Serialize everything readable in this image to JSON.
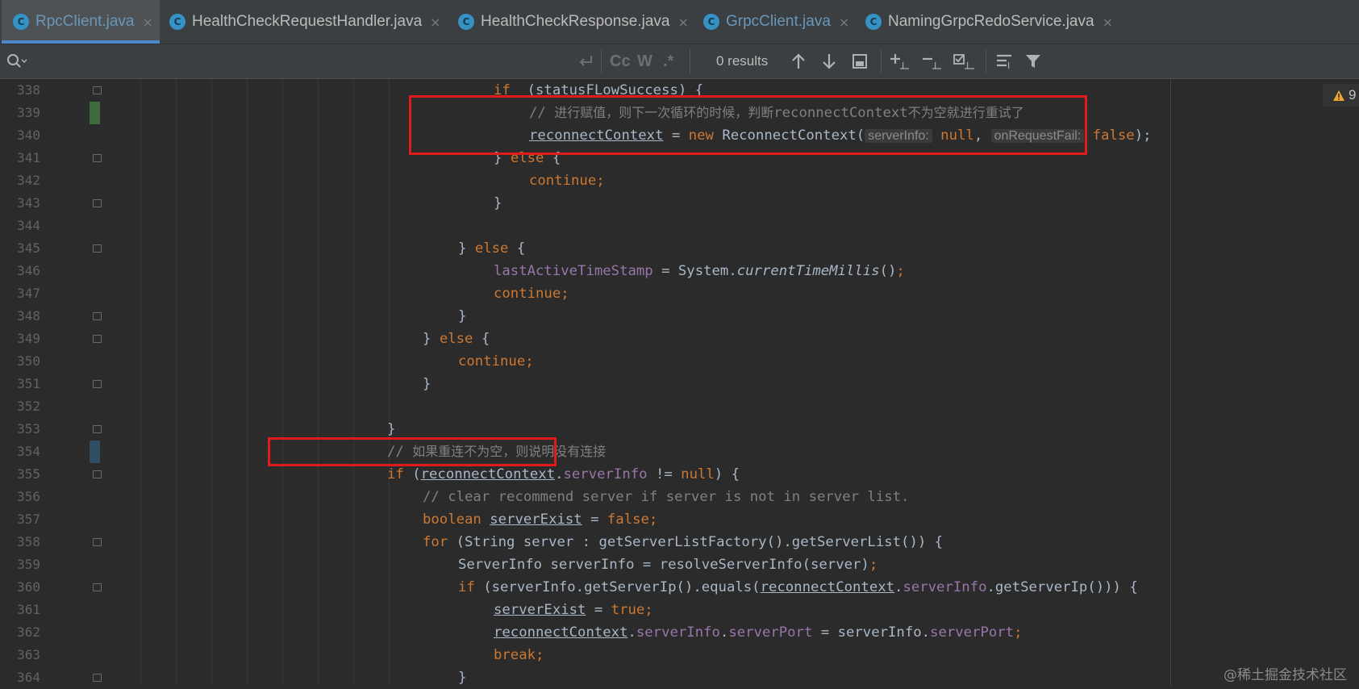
{
  "tabs": [
    {
      "label": "RpcClient.java",
      "active": true,
      "modified": true
    },
    {
      "label": "HealthCheckRequestHandler.java",
      "active": false,
      "modified": false
    },
    {
      "label": "HealthCheckResponse.java",
      "active": false,
      "modified": false
    },
    {
      "label": "GrpcClient.java",
      "active": false,
      "modified": true
    },
    {
      "label": "NamingGrpcRedoService.java",
      "active": false,
      "modified": false
    }
  ],
  "tab_icon_letter": "C",
  "tab_close_glyph": "×",
  "find": {
    "results": "0 results",
    "match_case": "Cc",
    "words": "W",
    "regex": ".*"
  },
  "warning": {
    "count": "9"
  },
  "watermark": "@稀土掘金技术社区",
  "lines": [
    {
      "n": "338",
      "indent": 11,
      "fold": true,
      "t": [
        [
          "kw",
          "if"
        ],
        [
          "",
          "  (statusFLowSuccess) {"
        ]
      ]
    },
    {
      "n": "339",
      "indent": 12,
      "mark": "#3e6b3c",
      "t": [
        [
          "cmt",
          "// "
        ],
        [
          "cmtcn",
          "进行赋值，则下一次循环的时候，判断"
        ],
        [
          "cmt",
          "reconnectContext"
        ],
        [
          "cmtcn",
          "不为空就进行重试了"
        ]
      ]
    },
    {
      "n": "340",
      "indent": 12,
      "t": [
        [
          "ul",
          "reconnectContext"
        ],
        [
          "",
          " = "
        ],
        [
          "kw",
          "new "
        ],
        [
          "",
          "ReconnectContext("
        ],
        [
          "hint",
          "serverInfo:"
        ],
        [
          "kw",
          " null"
        ],
        [
          "",
          ", "
        ],
        [
          "hint",
          "onRequestFail:"
        ],
        [
          "kw",
          " false"
        ],
        [
          "",
          ");"
        ]
      ]
    },
    {
      "n": "341",
      "indent": 11,
      "fold": true,
      "t": [
        [
          "",
          "} "
        ],
        [
          "kw",
          "else"
        ],
        [
          "",
          " {"
        ]
      ]
    },
    {
      "n": "342",
      "indent": 12,
      "t": [
        [
          "kw",
          "continue;"
        ]
      ]
    },
    {
      "n": "343",
      "indent": 11,
      "fold": true,
      "t": [
        [
          "",
          "}"
        ]
      ]
    },
    {
      "n": "344",
      "indent": 0,
      "t": []
    },
    {
      "n": "345",
      "indent": 10,
      "fold": true,
      "t": [
        [
          "",
          "} "
        ],
        [
          "kw",
          "else"
        ],
        [
          "",
          " {"
        ]
      ]
    },
    {
      "n": "346",
      "indent": 11,
      "t": [
        [
          "fld",
          "lastActiveTimeStamp"
        ],
        [
          "",
          " = System."
        ],
        [
          "it",
          "currentTimeMillis"
        ],
        [
          "",
          "()"
        ],
        [
          "kw",
          ";"
        ]
      ]
    },
    {
      "n": "347",
      "indent": 11,
      "t": [
        [
          "kw",
          "continue;"
        ]
      ]
    },
    {
      "n": "348",
      "indent": 10,
      "fold": true,
      "t": [
        [
          "",
          "}"
        ]
      ]
    },
    {
      "n": "349",
      "indent": 9,
      "fold": true,
      "t": [
        [
          "",
          "} "
        ],
        [
          "kw",
          "else"
        ],
        [
          "",
          " {"
        ]
      ]
    },
    {
      "n": "350",
      "indent": 10,
      "t": [
        [
          "kw",
          "continue;"
        ]
      ]
    },
    {
      "n": "351",
      "indent": 9,
      "fold": true,
      "t": [
        [
          "",
          "}"
        ]
      ]
    },
    {
      "n": "352",
      "indent": 0,
      "t": []
    },
    {
      "n": "353",
      "indent": 8,
      "fold": true,
      "t": [
        [
          "",
          "}"
        ]
      ]
    },
    {
      "n": "354",
      "indent": 8,
      "mark": "#2f4e63",
      "t": [
        [
          "cmt",
          "// "
        ],
        [
          "cmtcn",
          "如果重连不为空，则说明没有连接"
        ]
      ]
    },
    {
      "n": "355",
      "indent": 8,
      "fold": true,
      "t": [
        [
          "kw",
          "if"
        ],
        [
          "",
          " ("
        ],
        [
          "ul",
          "reconnectContext"
        ],
        [
          "",
          "."
        ],
        [
          "fld",
          "serverInfo"
        ],
        [
          "",
          " != "
        ],
        [
          "kw",
          "null"
        ],
        [
          "",
          ") {"
        ]
      ]
    },
    {
      "n": "356",
      "indent": 9,
      "t": [
        [
          "cmt",
          "// clear recommend server if server is not in server list."
        ]
      ]
    },
    {
      "n": "357",
      "indent": 9,
      "t": [
        [
          "kw",
          "boolean "
        ],
        [
          "ul",
          "serverExist"
        ],
        [
          "",
          " = "
        ],
        [
          "kw",
          "false;"
        ]
      ]
    },
    {
      "n": "358",
      "indent": 9,
      "fold": true,
      "t": [
        [
          "kw",
          "for"
        ],
        [
          "",
          " (String server : getServerListFactory().getServerList()) {"
        ]
      ]
    },
    {
      "n": "359",
      "indent": 10,
      "t": [
        [
          "",
          "ServerInfo serverInfo = resolveServerInfo(server)"
        ],
        [
          "kw",
          ";"
        ]
      ]
    },
    {
      "n": "360",
      "indent": 10,
      "fold": true,
      "t": [
        [
          "kw",
          "if"
        ],
        [
          "",
          " (serverInfo.getServerIp().equals("
        ],
        [
          "ul",
          "reconnectContext"
        ],
        [
          "",
          "."
        ],
        [
          "fld",
          "serverInfo"
        ],
        [
          "",
          ".getServerIp())) {"
        ]
      ]
    },
    {
      "n": "361",
      "indent": 11,
      "t": [
        [
          "ul",
          "serverExist"
        ],
        [
          "",
          " = "
        ],
        [
          "kw",
          "true;"
        ]
      ]
    },
    {
      "n": "362",
      "indent": 11,
      "t": [
        [
          "ul",
          "reconnectContext"
        ],
        [
          "",
          "."
        ],
        [
          "fld",
          "serverInfo"
        ],
        [
          "",
          "."
        ],
        [
          "fld",
          "serverPort"
        ],
        [
          "",
          " = serverInfo."
        ],
        [
          "fld",
          "serverPort"
        ],
        [
          "kw",
          ";"
        ]
      ]
    },
    {
      "n": "363",
      "indent": 11,
      "t": [
        [
          "kw",
          "break;"
        ]
      ]
    },
    {
      "n": "364",
      "indent": 10,
      "fold": true,
      "t": [
        [
          "",
          "}"
        ]
      ]
    }
  ]
}
